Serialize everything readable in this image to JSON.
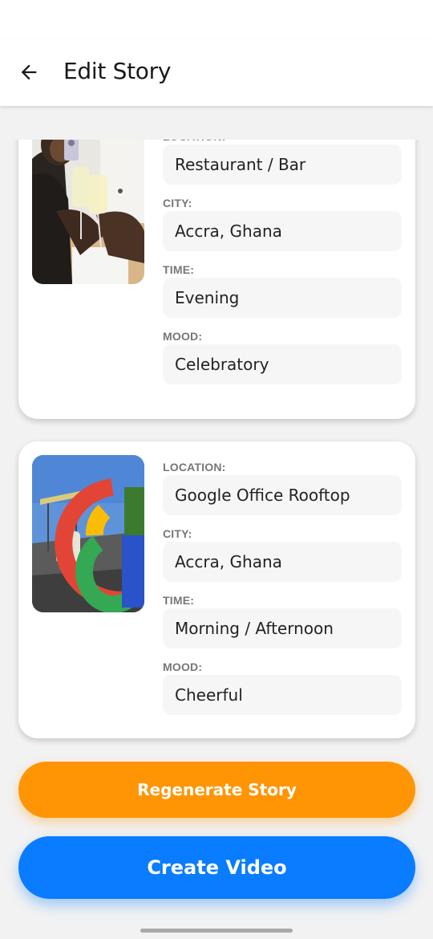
{
  "app_bar": {
    "title": "Edit Story"
  },
  "stories": [
    {
      "fields": [
        {
          "label": "LOCATION:",
          "value": "Restaurant / Bar"
        },
        {
          "label": "CITY:",
          "value": "Accra, Ghana"
        },
        {
          "label": "TIME:",
          "value": "Evening"
        },
        {
          "label": "MOOD:",
          "value": "Celebratory"
        }
      ]
    },
    {
      "fields": [
        {
          "label": "LOCATION:",
          "value": "Google Office Rooftop"
        },
        {
          "label": "CITY:",
          "value": "Accra, Ghana"
        },
        {
          "label": "TIME:",
          "value": "Morning / Afternoon"
        },
        {
          "label": "MOOD:",
          "value": "Cheerful"
        }
      ]
    }
  ],
  "actions": {
    "regenerate_label": "Regenerate Story",
    "create_label": "Create Video"
  },
  "colors": {
    "regenerate": "#ff9505",
    "create": "#0a7cff"
  }
}
